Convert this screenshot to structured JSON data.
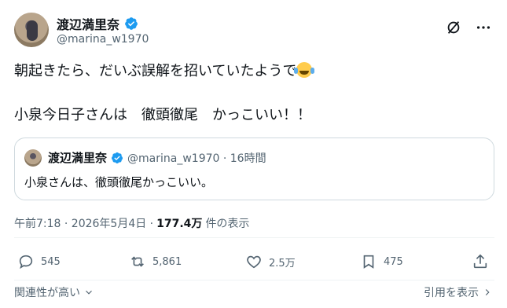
{
  "author": {
    "display_name": "渡辺満里奈",
    "handle": "@marina_w1970"
  },
  "tweet": {
    "line1": "朝起きたら、だいぶ誤解を招いていたようで",
    "line2": "小泉今日子さんは　徹頭徹尾　かっこいい！！"
  },
  "quote": {
    "display_name": "渡辺満里奈",
    "handle_time": "@marina_w1970 · 16時間",
    "text": "小泉さんは、徹頭徹尾かっこいい。"
  },
  "meta": {
    "timestamp": "午前7:18 · 2026年5月4日 ·",
    "views_count": "177.4万",
    "views_label": "件の表示"
  },
  "actions": {
    "replies": "545",
    "reposts": "5,861",
    "likes": "2.5万",
    "bookmarks": "475"
  },
  "footer": {
    "sort_label": "関連性が高い",
    "quotes_label": "引用を表示"
  },
  "colors": {
    "verified": "#1d9bf0",
    "text": "#0f1419",
    "muted": "#536471"
  }
}
